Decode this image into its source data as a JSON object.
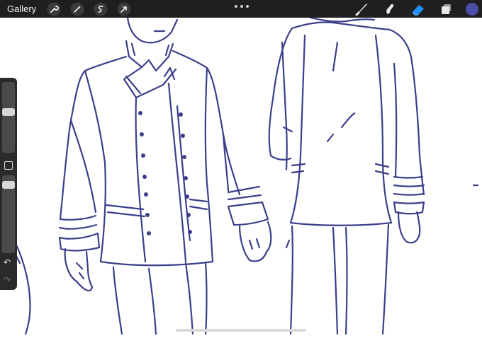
{
  "app": {
    "gallery_label": "Gallery",
    "actions": [
      {
        "name": "wrench-icon"
      },
      {
        "name": "magic-wand-icon"
      },
      {
        "name": "selection-icon"
      },
      {
        "name": "transform-arrow-icon"
      }
    ],
    "more_menu": "more-options-icon",
    "right_tools": [
      {
        "name": "brush-icon"
      },
      {
        "name": "smudge-icon"
      },
      {
        "name": "eraser-icon",
        "active": true
      },
      {
        "name": "layers-icon"
      }
    ],
    "current_color": "#4a4ea8"
  },
  "colors": {
    "toolbar_bg": "#1f1f1f",
    "sidebar_bg": "#2a2a2a",
    "ink": "#3b3f8a",
    "accent_blue": "#1e8fff"
  },
  "sidebar": {
    "brush_size_level": 0.58,
    "opacity_level": 0.92,
    "undo_icon": "undo-icon",
    "redo_icon": "redo-icon",
    "undo_glyph": "↶",
    "redo_glyph": "↷"
  },
  "canvas": {
    "subject": "pencil-sketch"
  }
}
